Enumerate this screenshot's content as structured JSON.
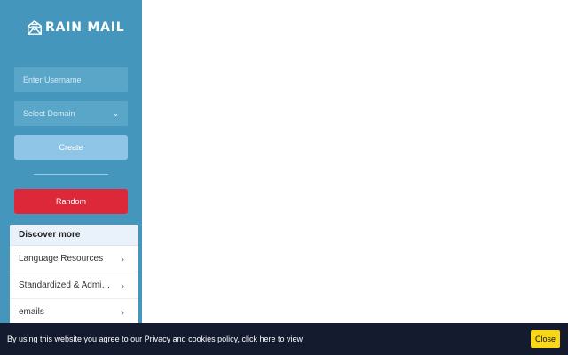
{
  "app": {
    "logo_text": "RAIN MAIL"
  },
  "form": {
    "username_placeholder": "Enter Username",
    "domain_select_label": "Select Domain",
    "create_label": "Create",
    "random_label": "Random"
  },
  "discover": {
    "title": "Discover more",
    "items": [
      {
        "label": "Language Resources"
      },
      {
        "label": "Standardized & Admissi..."
      },
      {
        "label": "emails"
      }
    ]
  },
  "cookie": {
    "text": "By using this website you agree to our Privacy and cookies policy, click here to view",
    "close_label": "Close"
  },
  "colors": {
    "sidebar": "#4596bd",
    "field": "#5aa6c9",
    "create": "#8fc6e8",
    "random": "#dc2839",
    "cookie_bar": "#141b2e",
    "close": "#f8d716"
  },
  "icons": [
    "envelope-logo-icon",
    "chevron-down-icon",
    "chevron-right-icon"
  ]
}
